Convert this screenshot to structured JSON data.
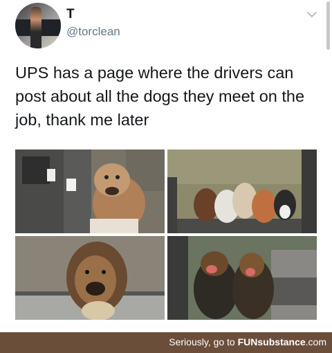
{
  "tweet": {
    "display_name": "T",
    "handle": "@torclean",
    "text": "UPS has a page where the drivers can post about all the dogs they meet on the job, thank me later",
    "photos": [
      "dog-photo-1",
      "dog-photo-2",
      "dog-photo-3",
      "dog-photo-4"
    ]
  },
  "icons": {
    "menu": "chevron-down-icon"
  },
  "footer": {
    "prefix": "Seriously, go to ",
    "brand": "FUNsubstance",
    "suffix": ".com"
  },
  "colors": {
    "text": "#14171a",
    "muted": "#657786",
    "footer_bg": "#6b4e3a"
  }
}
